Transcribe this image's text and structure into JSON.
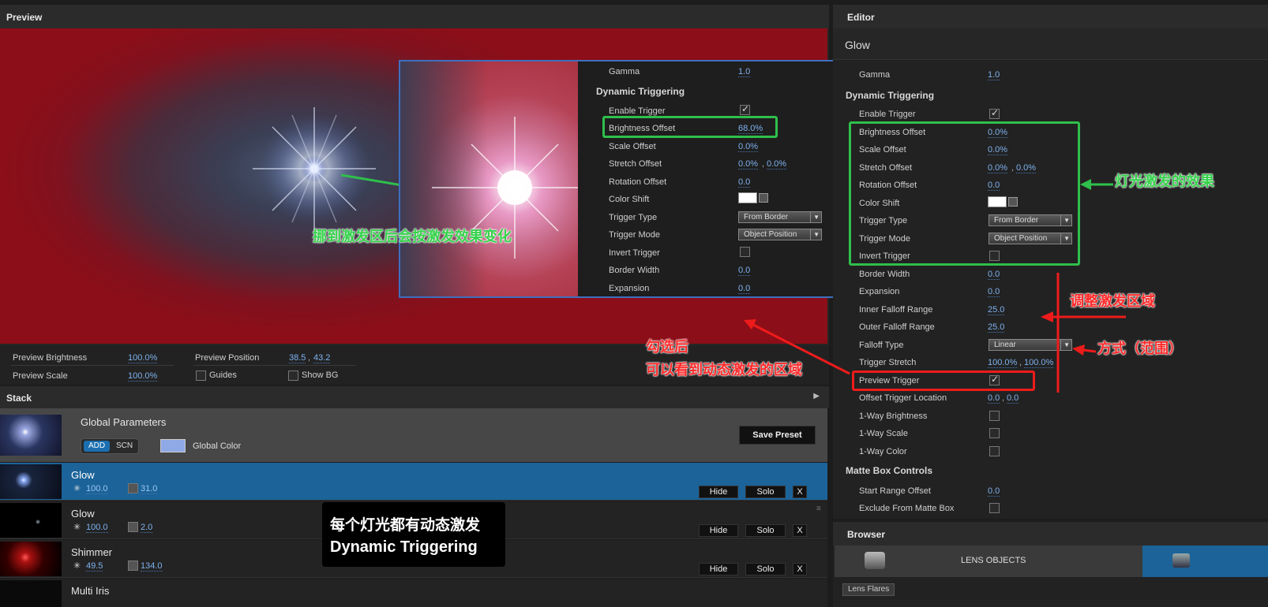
{
  "preview": {
    "title": "Preview",
    "brightness_label": "Preview Brightness",
    "brightness_value": "100.0%",
    "scale_label": "Preview Scale",
    "scale_value": "100.0%",
    "position_label": "Preview Position",
    "position_x": "38.5",
    "position_y": "43.2",
    "guides_label": "Guides",
    "show_bg_label": "Show BG"
  },
  "inset": {
    "gamma_label": "Gamma",
    "gamma_value": "1.0",
    "section": "Dynamic Triggering",
    "enable_label": "Enable Trigger",
    "brightness_label": "Brightness Offset",
    "brightness_value": "68.0%",
    "scale_label": "Scale Offset",
    "scale_value": "0.0%",
    "stretch_label": "Stretch Offset",
    "stretch_x": "0.0%",
    "stretch_y": "0.0%",
    "rotation_label": "Rotation Offset",
    "rotation_value": "0.0",
    "color_label": "Color Shift",
    "type_label": "Trigger Type",
    "type_value": "From Border",
    "mode_label": "Trigger Mode",
    "mode_value": "Object Position",
    "invert_label": "Invert Trigger",
    "border_label": "Border Width",
    "border_value": "0.0",
    "expansion_label": "Expansion",
    "expansion_value": "0.0"
  },
  "editor": {
    "title": "Editor",
    "object_name": "Glow",
    "gamma_label": "Gamma",
    "gamma_value": "1.0",
    "section_dt": "Dynamic Triggering",
    "enable_label": "Enable Trigger",
    "brightness_label": "Brightness Offset",
    "brightness_value": "0.0%",
    "scale_label": "Scale Offset",
    "scale_value": "0.0%",
    "stretch_label": "Stretch Offset",
    "stretch_x": "0.0%",
    "stretch_y": "0.0%",
    "rotation_label": "Rotation Offset",
    "rotation_value": "0.0",
    "color_label": "Color Shift",
    "type_label": "Trigger Type",
    "type_value": "From Border",
    "mode_label": "Trigger Mode",
    "mode_value": "Object Position",
    "invert_label": "Invert Trigger",
    "border_label": "Border Width",
    "border_value": "0.0",
    "expansion_label": "Expansion",
    "expansion_value": "0.0",
    "inner_label": "Inner Falloff Range",
    "inner_value": "25.0",
    "outer_label": "Outer Falloff Range",
    "outer_value": "25.0",
    "falloff_type_label": "Falloff Type",
    "falloff_type_value": "Linear",
    "trig_stretch_label": "Trigger Stretch",
    "trig_stretch_x": "100.0%",
    "trig_stretch_y": "100.0%",
    "preview_trigger_label": "Preview Trigger",
    "offset_loc_label": "Offset Trigger Location",
    "offset_loc_x": "0.0",
    "offset_loc_y": "0.0",
    "oneway_brightness_label": "1-Way Brightness",
    "oneway_scale_label": "1-Way Scale",
    "oneway_color_label": "1-Way Color",
    "section_matte": "Matte Box Controls",
    "start_range_label": "Start Range Offset",
    "start_range_value": "0.0",
    "exclude_label": "Exclude From Matte Box"
  },
  "stack": {
    "title": "Stack",
    "global_title": "Global Parameters",
    "add_label": "ADD",
    "scn_label": "SCN",
    "global_color_label": "Global Color",
    "save_preset_label": "Save Preset",
    "layers": [
      {
        "name": "Glow",
        "brightness": "100.0",
        "scale": "31.0"
      },
      {
        "name": "Glow",
        "brightness": "100.0",
        "scale": "2.0"
      },
      {
        "name": "Shimmer",
        "brightness": "49.5",
        "scale": "134.0"
      },
      {
        "name": "Multi Iris"
      }
    ],
    "hide_label": "Hide",
    "solo_label": "Solo",
    "x_label": "X"
  },
  "browser": {
    "title": "Browser",
    "tab_label": "LENS OBJECTS",
    "sub_tab_label": "Lens Flares"
  },
  "annotations": {
    "green_center": "挪到激发区后会按激发效果变化",
    "green_right": "灯光激发的效果",
    "red_area": "调整激发区域",
    "red_mode": "方式（范围）",
    "red_check_line1": "勾选后",
    "red_check_line2": "可以看到动态激发的区域",
    "caption_line1": "每个灯光都有动态激发",
    "caption_line2": "Dynamic Triggering"
  },
  "colors": {
    "accent_blue": "#1b6399",
    "value_blue": "#7eb2ee",
    "annotation_green": "#2fbf4b",
    "annotation_red": "#ee1b1b"
  }
}
